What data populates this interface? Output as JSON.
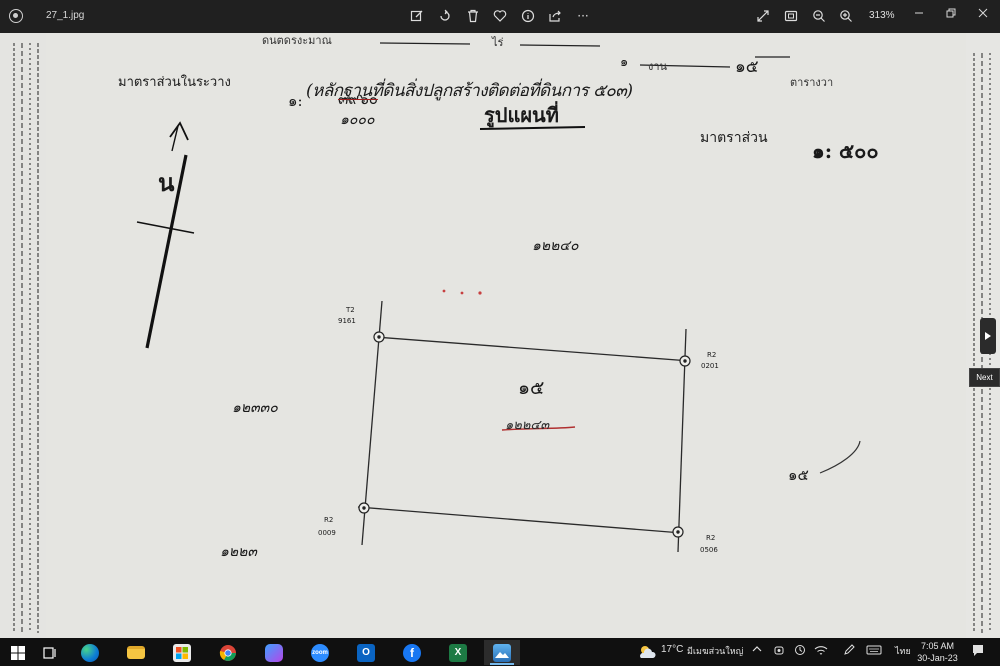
{
  "window": {
    "file_name": "27_1.jpg",
    "zoom": "313%"
  },
  "toolbar": {
    "icons": [
      "edit-icon",
      "rotate-icon",
      "delete-icon",
      "favorite-icon",
      "info-icon",
      "share-icon",
      "more-icon"
    ],
    "right_icons": [
      "fullscreen-icon",
      "fit-icon",
      "zoom-out-icon",
      "zoom-in-icon"
    ],
    "more_label": "···"
  },
  "document": {
    "header_partial": "ดนตดรงะมาณ",
    "header_unit_rai": "ไร่",
    "header_ngan": "๑",
    "header_ngan_unit": "งาน",
    "header_wa": "๑๕",
    "header_wa_unit": "ตารางวา",
    "handwritten_note": "(หลักฐานที่ดินสิ่งปลูกสร้างติดต่อที่ดินการ ๕๐๓)",
    "scale_between_label": "มาตราส่วนในระวาง",
    "scale_between_prefix": "๑:",
    "scale_between_old": "๓๙๖๐",
    "scale_between_new": "๑๐๐๐",
    "map_title": "รูปแผนที่",
    "scale_label": "มาตราส่วน",
    "scale_value": "๑: ๕๐๐",
    "north_letter": "น",
    "parcel_north": "๑๒๒๔๐",
    "parcel_west": "๑๒๓๓๐",
    "parcel_south": "๑๒๒๓",
    "parcel_east": "๑๕",
    "plot_number": "๑๕",
    "plot_parcel": "๑๒๒๔๓",
    "markers": {
      "top_left_code": "T2",
      "top_left_num": "9161",
      "top_right_code": "R2",
      "top_right_num": "0201",
      "bottom_left_code": "R2",
      "bottom_left_num": "0009",
      "bottom_right_code": "R2",
      "bottom_right_num": "0506"
    }
  },
  "navigation": {
    "next_label": "Next"
  },
  "taskbar": {
    "apps": [
      "windows-start-icon",
      "task-view-icon",
      "edge-icon",
      "file-explorer-icon",
      "store-icon",
      "chrome-icon",
      "copilot-icon",
      "zoom-app-icon",
      "outlook-icon",
      "facebook-icon",
      "excel-icon",
      "photos-icon"
    ],
    "weather_temp": "17°C",
    "weather_text": "มีเมฆส่วนใหญ่",
    "language": "ไทย",
    "time": "7:05 AM",
    "date": "30-Jan-23"
  }
}
